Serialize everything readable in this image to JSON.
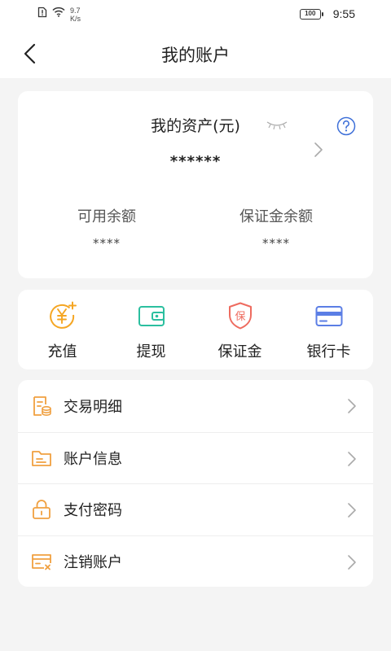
{
  "status_bar": {
    "net_speed_value": "9.7",
    "net_speed_unit": "K/s",
    "battery": "100",
    "time": "9:55"
  },
  "nav": {
    "title": "我的账户",
    "back_icon": "chevron-left-icon"
  },
  "assets": {
    "title": "我的资产(元)",
    "value": "******",
    "available_label": "可用余额",
    "available_value": "****",
    "deposit_label": "保证金余额",
    "deposit_value": "****",
    "eye_icon": "eye-closed-icon",
    "help_icon": "question-icon"
  },
  "actions": [
    {
      "label": "充值",
      "icon": "yen-plus-icon",
      "color": "#f5a623"
    },
    {
      "label": "提现",
      "icon": "wallet-icon",
      "color": "#2bbf9f"
    },
    {
      "label": "保证金",
      "icon": "shield-icon",
      "color": "#ee6b5f",
      "glyph": "保"
    },
    {
      "label": "银行卡",
      "icon": "bank-card-icon",
      "color": "#5b7ee5"
    }
  ],
  "menu": [
    {
      "label": "交易明细",
      "icon": "transaction-detail-icon"
    },
    {
      "label": "账户信息",
      "icon": "folder-icon"
    },
    {
      "label": "支付密码",
      "icon": "lock-icon"
    },
    {
      "label": "注销账户",
      "icon": "cancel-card-icon"
    }
  ],
  "colors": {
    "accent_orange": "#f0a040",
    "background": "#f4f4f4"
  }
}
